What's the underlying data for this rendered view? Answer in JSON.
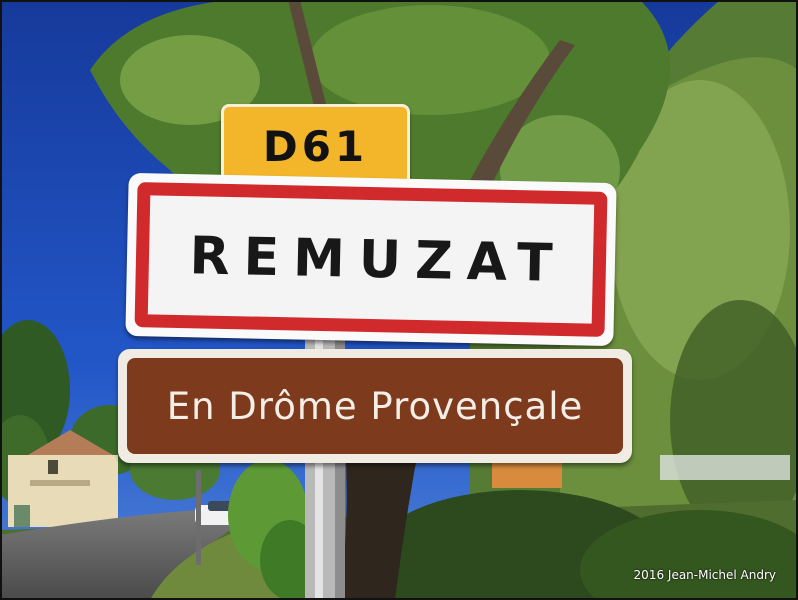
{
  "scene": {
    "kind": "photo",
    "colors": {
      "sky": "#1d46b8",
      "foliage": "#3f6f2a",
      "route_sign": "#f3b62a",
      "town_border": "#d02a2d",
      "region_sign": "#7d3a1d"
    }
  },
  "signs": {
    "route": "D61",
    "town": "REMUZAT",
    "region": "En Drôme Provençale"
  },
  "credit": "2016 Jean-Michel Andry"
}
